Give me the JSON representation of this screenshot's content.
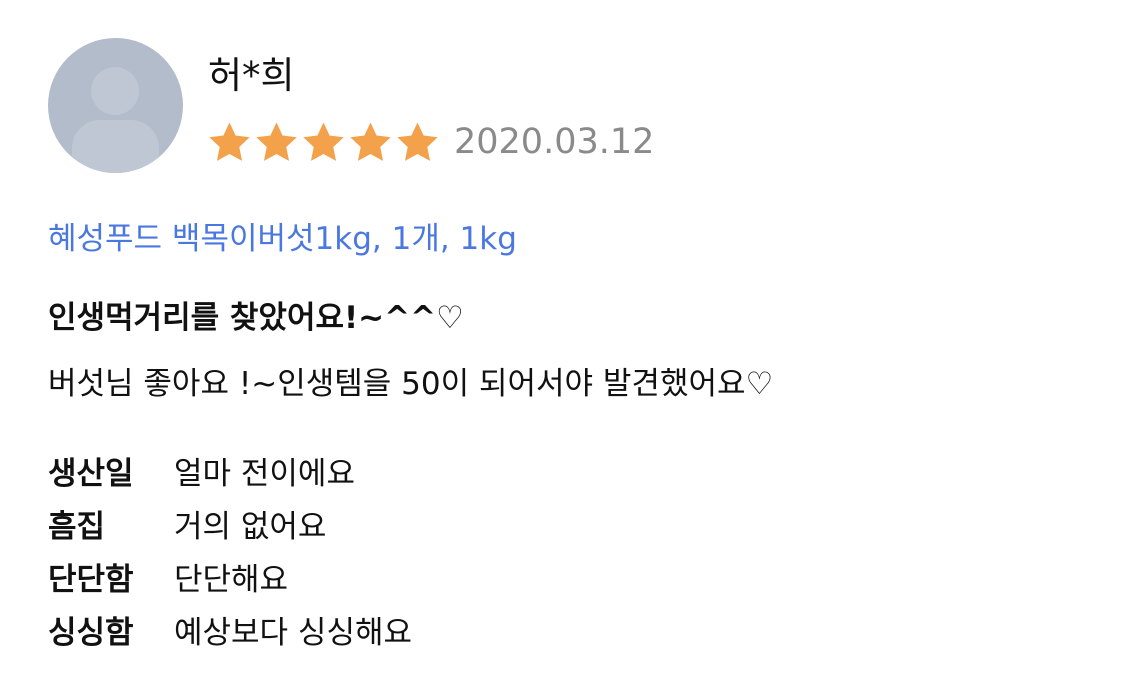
{
  "reviewer": {
    "name": "허*희"
  },
  "rating": {
    "value": 5,
    "max": 5,
    "star_color": "#f3a14a"
  },
  "review_date": "2020.03.12",
  "product_option": "혜성푸드 백목이버섯1kg, 1개, 1kg",
  "headline": "인생먹거리를 찾았어요!~^^♡",
  "body": "버섯님 좋아요 !~인생템을 50이 되어서야 발견했어요♡",
  "survey": [
    {
      "label": "생산일",
      "value": "얼마 전이에요"
    },
    {
      "label": "흠집",
      "value": "거의 없어요"
    },
    {
      "label": "단단함",
      "value": "단단해요"
    },
    {
      "label": "싱싱함",
      "value": "예상보다 싱싱해요"
    }
  ],
  "colors": {
    "link": "#4a78e0",
    "date": "#8a8a8a",
    "avatar_bg": "#b3bccb"
  }
}
